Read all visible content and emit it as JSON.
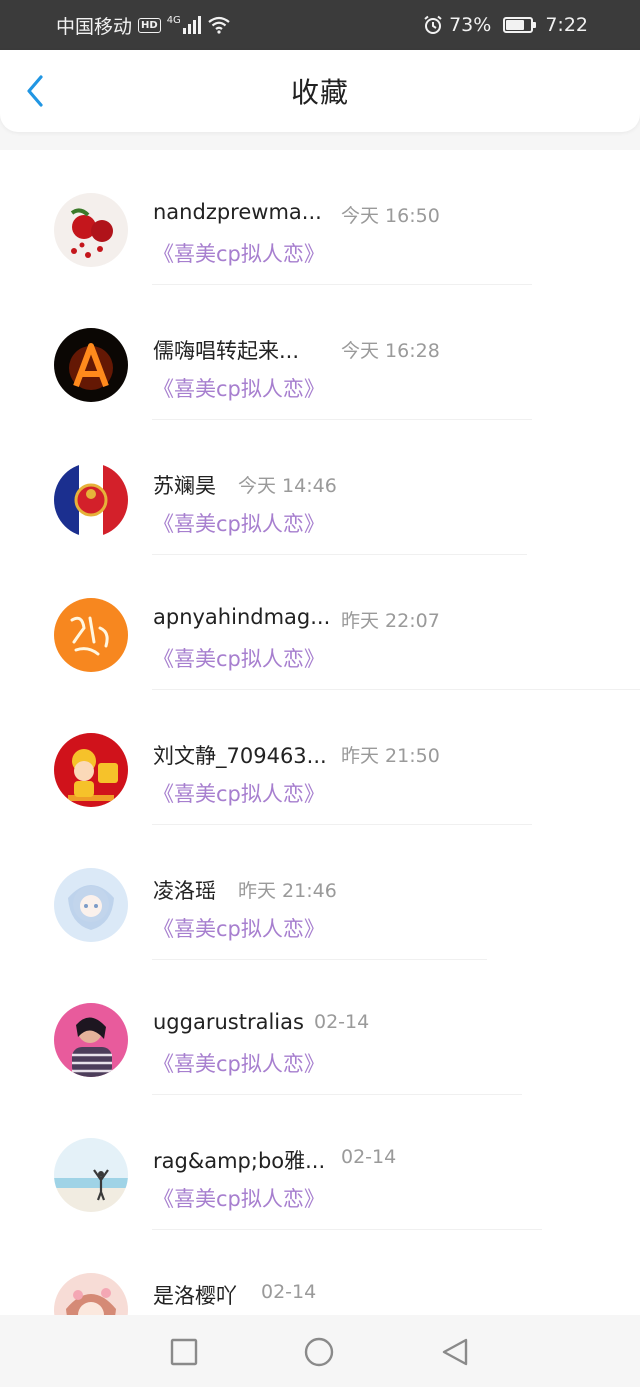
{
  "status_bar": {
    "carrier": "中国移动",
    "hd": "HD",
    "network": "4G",
    "battery": "73%",
    "battery_level": 0.73,
    "time": "7:22"
  },
  "header": {
    "title": "收藏"
  },
  "items": [
    {
      "name": "nandzprewma...",
      "time": "今天 16:50",
      "book": "《喜美cp拟人恋》",
      "avatar": "roses-avatar"
    },
    {
      "name": "儒嗨唱转起来...",
      "time": "今天 16:28",
      "book": "《喜美cp拟人恋》",
      "avatar": "fire-letter-a-avatar"
    },
    {
      "name": "苏斓昊",
      "time": "今天 14:46",
      "book": "《喜美cp拟人恋》",
      "avatar": "emblem-flag-avatar"
    },
    {
      "name": "apnyahindmag...",
      "time": "昨天 22:07",
      "book": "《喜美cp拟人恋》",
      "avatar": "orange-calligraphy-avatar"
    },
    {
      "name": "刘文静_709463...",
      "time": "昨天 21:50",
      "book": "《喜美cp拟人恋》",
      "avatar": "red-new-year-avatar"
    },
    {
      "name": "凌洛瑶",
      "time": "昨天 21:46",
      "book": "《喜美cp拟人恋》",
      "avatar": "anime-blue-avatar"
    },
    {
      "name": "uggarustralias",
      "time": "02-14",
      "book": "《喜美cp拟人恋》",
      "avatar": "portrait-woman-avatar"
    },
    {
      "name": "rag&amp;bo雅...",
      "time": "02-14",
      "book": "《喜美cp拟人恋》",
      "avatar": "beach-avatar"
    },
    {
      "name": "是洛樱吖",
      "time": "02-14",
      "book": "",
      "avatar": "anime-pink-avatar"
    }
  ],
  "colors": {
    "accent_back": "#2196e3",
    "book_link": "#a77fcf",
    "time_gray": "#9a9a9a"
  },
  "nav_bar": {
    "icons": [
      "square-icon",
      "circle-icon",
      "triangle-back-icon"
    ]
  }
}
